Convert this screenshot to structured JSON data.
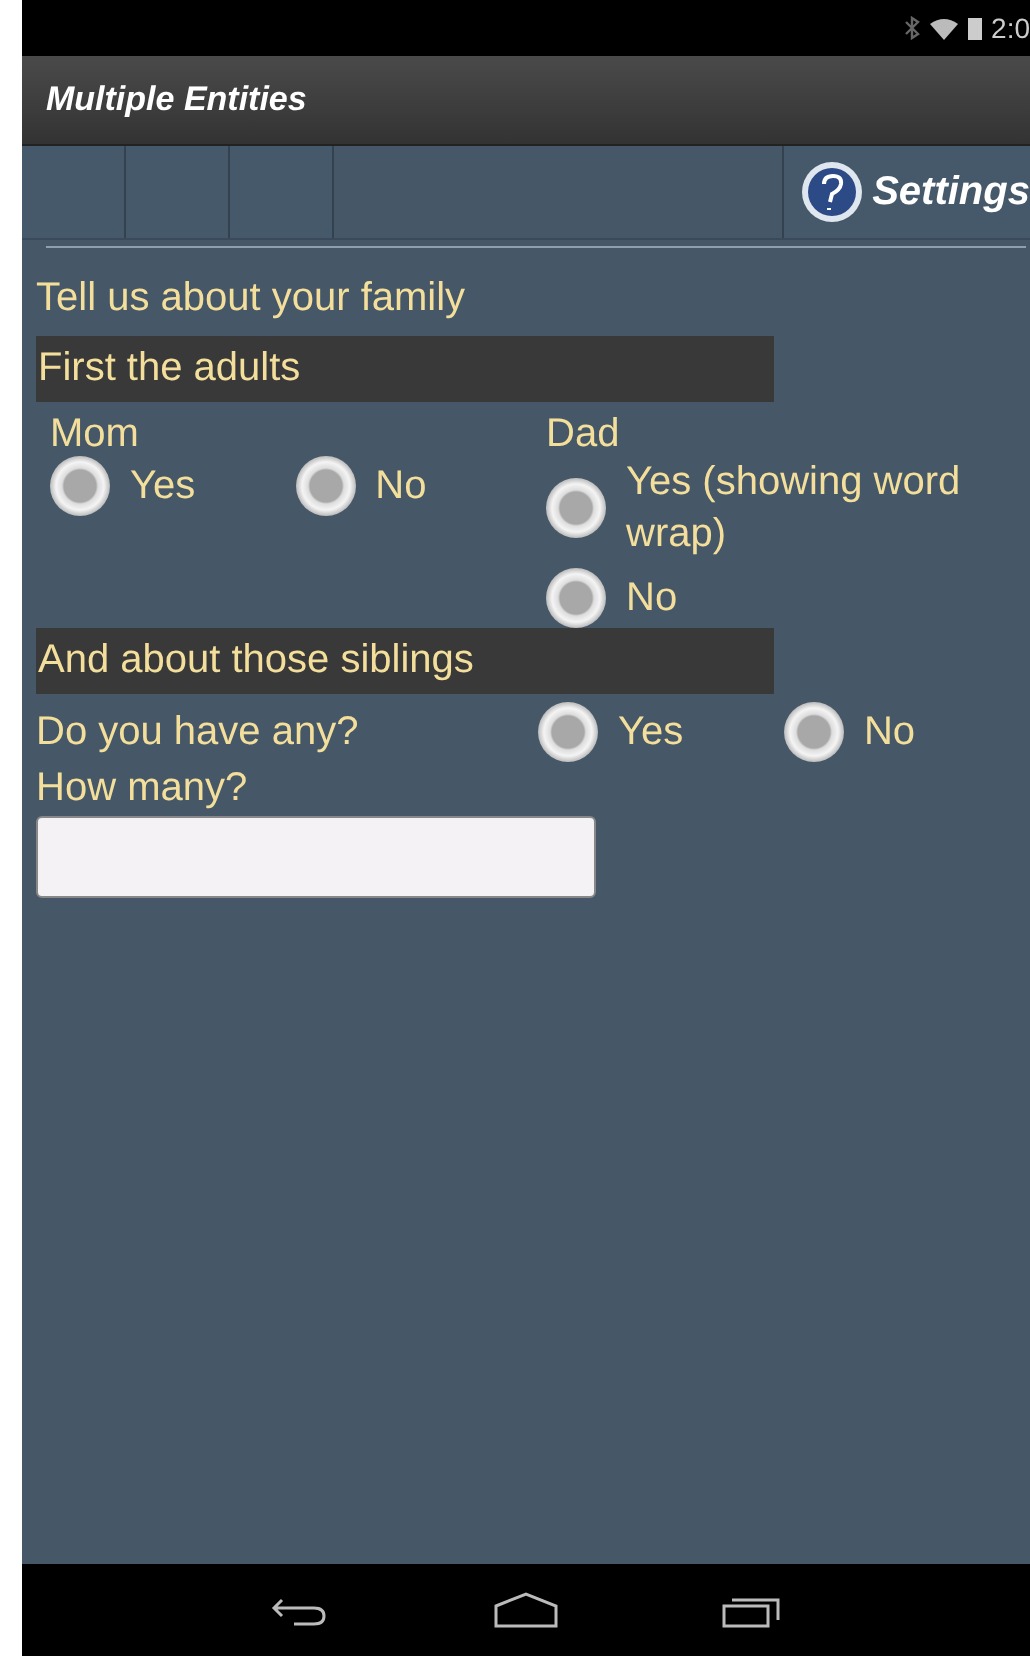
{
  "status_bar": {
    "time": "2:0"
  },
  "window": {
    "title": "Multiple Entities"
  },
  "toolbar": {
    "settings_label": "Settings"
  },
  "form": {
    "intro": "Tell us about your family",
    "sections": [
      {
        "heading": "First the adults",
        "kind": "columns",
        "groups": [
          {
            "label": "Mom",
            "kind": "row",
            "options": [
              {
                "label": "Yes",
                "selected": false
              },
              {
                "label": "No",
                "selected": false
              }
            ]
          },
          {
            "label": "Dad",
            "kind": "column",
            "options": [
              {
                "label": "Yes (showing word wrap)",
                "selected": false
              },
              {
                "label": "No",
                "selected": false
              }
            ]
          }
        ]
      },
      {
        "heading": "And about those siblings",
        "kind": "questions",
        "question": "Do you have any?",
        "options": [
          {
            "label": "Yes",
            "selected": false
          },
          {
            "label": "No",
            "selected": false
          }
        ],
        "count_label": "How many?"
      }
    ]
  }
}
